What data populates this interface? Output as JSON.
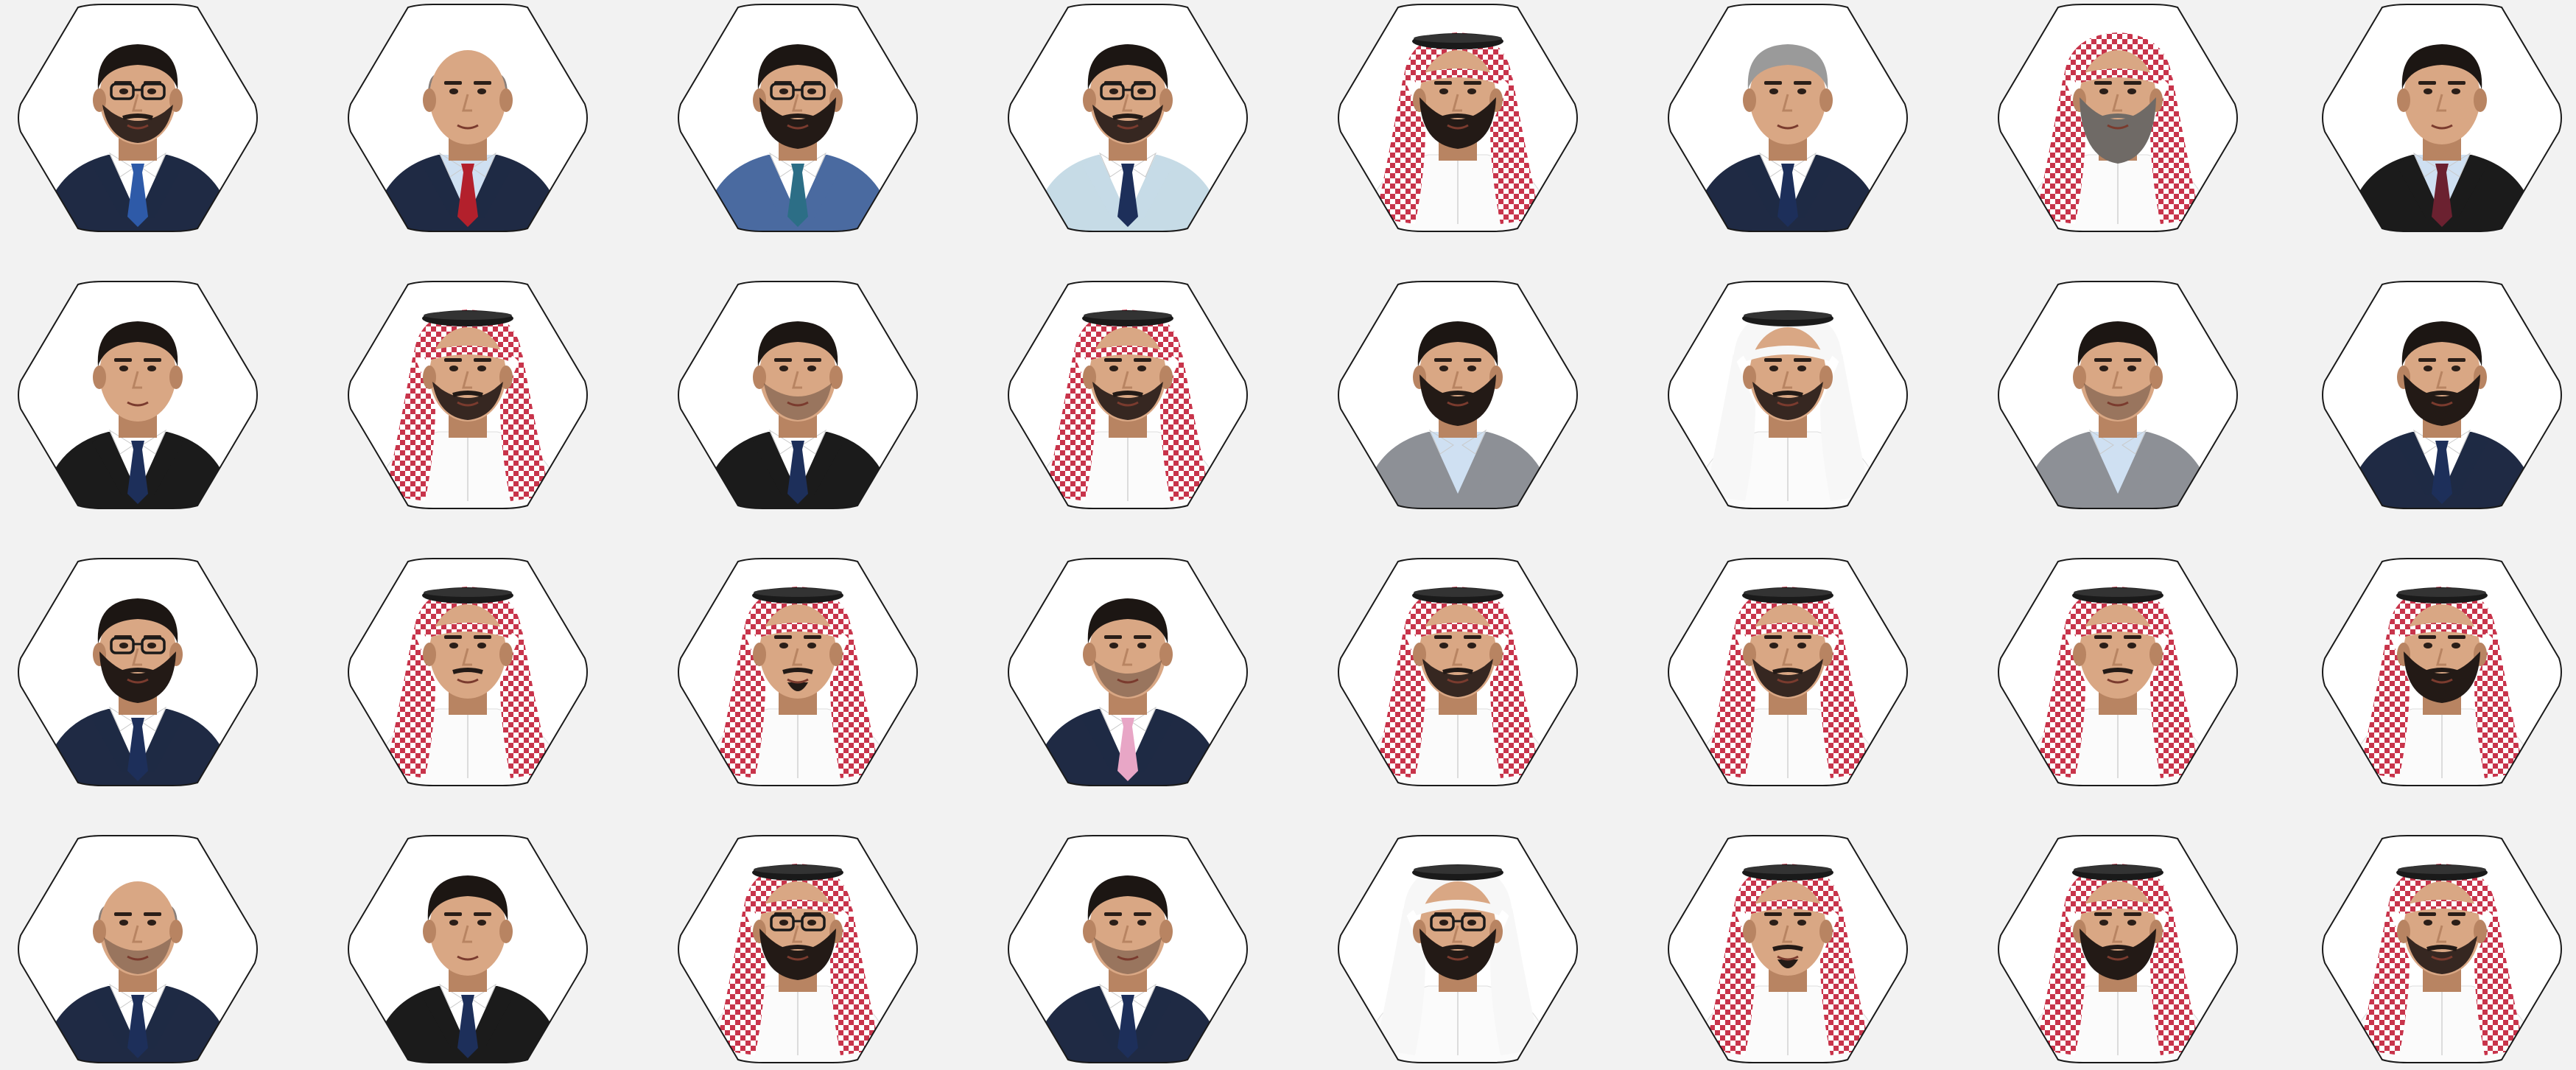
{
  "page": {
    "background": "#f2f2f2"
  },
  "palette": {
    "hex_fill": "#ffffff",
    "hex_stroke": "#1a1a1a",
    "skin": "#d9a784",
    "skin_dark": "#b88462",
    "hair_dark": "#1c1613",
    "hair_grey": "#9a9a9a",
    "navy_suit": "#1f2a44",
    "black_suit": "#1b1b1b",
    "grey_suit": "#8d9096",
    "blue_suit": "#4a6aa0",
    "light_blue_suit": "#c6dbe6",
    "shirt_white": "#ffffff",
    "shirt_lightblue": "#cfe0f2",
    "tie_blue": "#2e5aa8",
    "tie_red": "#b3202c",
    "tie_navy": "#1d2f5a",
    "tie_pink": "#e8a6c6",
    "tie_maroon": "#6b2130",
    "tie_teal": "#2c6e86",
    "shemagh_red": "#c8344b",
    "ghutra_white": "#f7f7f7",
    "agal_black": "#1a1a1a",
    "thobe_white": "#fbfbfb"
  },
  "portraits": [
    {
      "row": 0,
      "col": 0,
      "attire": "suit",
      "suit": "navy_suit",
      "shirt": "shirt_white",
      "tie": "tie_blue",
      "hair": "hair_dark",
      "beard": "short",
      "glasses": true
    },
    {
      "row": 0,
      "col": 1,
      "attire": "suit",
      "suit": "navy_suit",
      "shirt": "shirt_lightblue",
      "tie": "tie_red",
      "hair": "bald",
      "beard": "none",
      "glasses": false
    },
    {
      "row": 0,
      "col": 2,
      "attire": "suit",
      "suit": "blue_suit",
      "shirt": "shirt_white",
      "tie": "tie_teal",
      "hair": "hair_dark",
      "beard": "full",
      "glasses": true
    },
    {
      "row": 0,
      "col": 3,
      "attire": "suit",
      "suit": "light_blue_suit",
      "shirt": "shirt_white",
      "tie": "tie_navy",
      "hair": "hair_dark",
      "beard": "short",
      "glasses": true
    },
    {
      "row": 0,
      "col": 4,
      "attire": "shemagh",
      "beard": "full",
      "glasses": false
    },
    {
      "row": 0,
      "col": 5,
      "attire": "suit",
      "suit": "navy_suit",
      "shirt": "shirt_white",
      "tie": "tie_navy",
      "hair": "hair_grey",
      "beard": "none",
      "glasses": false
    },
    {
      "row": 0,
      "col": 6,
      "attire": "shemagh_noagal",
      "beard": "grey_long",
      "glasses": false
    },
    {
      "row": 0,
      "col": 7,
      "attire": "suit",
      "suit": "black_suit",
      "shirt": "shirt_lightblue",
      "tie": "tie_maroon",
      "hair": "hair_dark",
      "beard": "none",
      "glasses": false
    },
    {
      "row": 1,
      "col": 0,
      "attire": "suit",
      "suit": "black_suit",
      "shirt": "shirt_white",
      "tie": "tie_navy",
      "hair": "hair_dark",
      "beard": "none",
      "glasses": false
    },
    {
      "row": 1,
      "col": 1,
      "attire": "shemagh",
      "beard": "short",
      "glasses": false
    },
    {
      "row": 1,
      "col": 2,
      "attire": "suit",
      "suit": "black_suit",
      "shirt": "shirt_white",
      "tie": "tie_navy",
      "hair": "hair_dark",
      "beard": "stubble",
      "glasses": false
    },
    {
      "row": 1,
      "col": 3,
      "attire": "shemagh",
      "beard": "short",
      "glasses": false
    },
    {
      "row": 1,
      "col": 4,
      "attire": "blazer",
      "suit": "grey_suit",
      "shirt": "shirt_lightblue",
      "tie": "",
      "hair": "hair_dark",
      "beard": "full",
      "glasses": false
    },
    {
      "row": 1,
      "col": 5,
      "attire": "ghutra",
      "beard": "short",
      "glasses": false
    },
    {
      "row": 1,
      "col": 6,
      "attire": "blazer",
      "suit": "grey_suit",
      "shirt": "shirt_lightblue",
      "tie": "",
      "hair": "hair_dark",
      "beard": "stubble",
      "glasses": false
    },
    {
      "row": 1,
      "col": 7,
      "attire": "suit",
      "suit": "navy_suit",
      "shirt": "shirt_white",
      "tie": "tie_navy",
      "hair": "hair_dark",
      "beard": "full",
      "glasses": false
    },
    {
      "row": 2,
      "col": 0,
      "attire": "suit",
      "suit": "navy_suit",
      "shirt": "shirt_white",
      "tie": "tie_navy",
      "hair": "hair_dark",
      "beard": "full",
      "glasses": true
    },
    {
      "row": 2,
      "col": 1,
      "attire": "shemagh",
      "beard": "mustache",
      "glasses": false
    },
    {
      "row": 2,
      "col": 2,
      "attire": "shemagh",
      "beard": "goatee",
      "glasses": false
    },
    {
      "row": 2,
      "col": 3,
      "attire": "suit",
      "suit": "navy_suit",
      "shirt": "shirt_white",
      "tie": "tie_pink",
      "hair": "hair_dark",
      "beard": "stubble",
      "glasses": false
    },
    {
      "row": 2,
      "col": 4,
      "attire": "shemagh",
      "beard": "short",
      "glasses": false
    },
    {
      "row": 2,
      "col": 5,
      "attire": "shemagh",
      "beard": "short",
      "glasses": false
    },
    {
      "row": 2,
      "col": 6,
      "attire": "shemagh",
      "beard": "mustache",
      "glasses": false
    },
    {
      "row": 2,
      "col": 7,
      "attire": "shemagh",
      "beard": "full",
      "glasses": false
    },
    {
      "row": 3,
      "col": 0,
      "attire": "suit",
      "suit": "navy_suit",
      "shirt": "shirt_white",
      "tie": "tie_navy",
      "hair": "bald",
      "beard": "stubble",
      "glasses": false
    },
    {
      "row": 3,
      "col": 1,
      "attire": "suit",
      "suit": "black_suit",
      "shirt": "shirt_white",
      "tie": "tie_navy",
      "hair": "hair_dark",
      "beard": "none",
      "glasses": false
    },
    {
      "row": 3,
      "col": 2,
      "attire": "shemagh",
      "beard": "full",
      "glasses": true
    },
    {
      "row": 3,
      "col": 3,
      "attire": "suit",
      "suit": "navy_suit",
      "shirt": "shirt_white",
      "tie": "tie_navy",
      "hair": "hair_dark",
      "beard": "stubble",
      "glasses": false
    },
    {
      "row": 3,
      "col": 4,
      "attire": "ghutra",
      "beard": "full",
      "glasses": true
    },
    {
      "row": 3,
      "col": 5,
      "attire": "shemagh",
      "beard": "goatee",
      "glasses": false
    },
    {
      "row": 3,
      "col": 6,
      "attire": "shemagh",
      "beard": "full",
      "glasses": false
    },
    {
      "row": 3,
      "col": 7,
      "attire": "shemagh",
      "beard": "short",
      "glasses": false
    }
  ]
}
